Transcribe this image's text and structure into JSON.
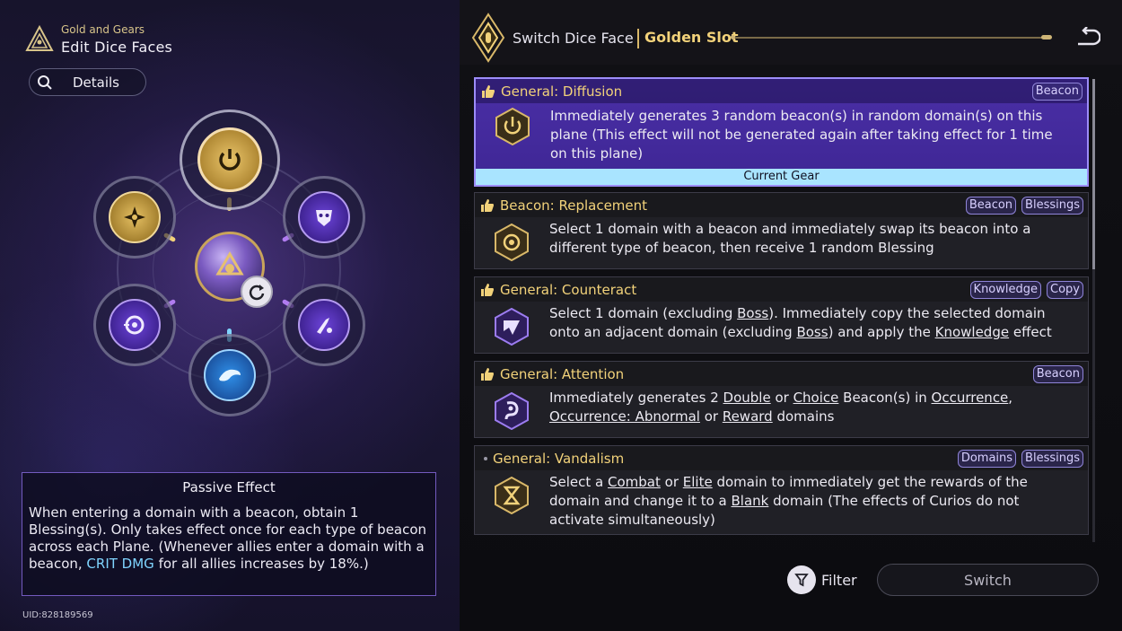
{
  "header": {
    "subtitle": "Gold and Gears",
    "title": "Edit Dice Faces",
    "logo_icon": "triangle-emblem-icon"
  },
  "details_button": {
    "label": "Details",
    "icon": "search-icon"
  },
  "dice_faces": [
    {
      "position": "top",
      "icon": "power-icon",
      "style": "gold"
    },
    {
      "position": "upper-left",
      "icon": "shuriken-icon",
      "style": "gold"
    },
    {
      "position": "upper-right",
      "icon": "mask-icon",
      "style": "purple"
    },
    {
      "position": "lower-left",
      "icon": "target-icon",
      "style": "purple"
    },
    {
      "position": "lower-right",
      "icon": "knife-icon",
      "style": "purple"
    },
    {
      "position": "bottom",
      "icon": "bird-icon",
      "style": "blue"
    }
  ],
  "passive": {
    "title": "Passive Effect",
    "text_before": "When entering a domain with a beacon, obtain 1 Blessing(s). Only takes effect once for each type of beacon across each Plane. (Whenever allies enter a domain with a beacon, ",
    "highlight": "CRIT DMG",
    "text_after": " for all allies increases by 18%.)"
  },
  "uid": "UID:828189569",
  "topbar": {
    "title": "Switch Dice Face",
    "slot": "Golden Slot"
  },
  "cards": [
    {
      "title": "General: Diffusion",
      "tags": [
        "Beacon"
      ],
      "selected": true,
      "icon": "power-icon",
      "desc": "Immediately generates 3 random beacon(s) in random domain(s) on this plane (This effect will not be generated again after taking effect for 1 time on this plane)",
      "current_label": "Current Gear"
    },
    {
      "title": "Beacon: Replacement",
      "tags": [
        "Beacon",
        "Blessings"
      ],
      "icon": "target-ring-icon",
      "desc": "Select 1 domain with a beacon and immediately swap its beacon into a different type of beacon, then receive 1 random Blessing"
    },
    {
      "title": "General: Counteract",
      "tags": [
        "Knowledge",
        "Copy"
      ],
      "icon": "arrow-swirl-icon",
      "desc_parts": [
        "Select 1 domain (excluding ",
        "Boss",
        "). Immediately copy the selected domain onto an adjacent domain (excluding ",
        "Boss",
        ") and apply the ",
        "Knowledge",
        " effect"
      ]
    },
    {
      "title": "General: Attention",
      "tags": [
        "Beacon"
      ],
      "icon": "hook-icon",
      "desc_parts": [
        "Immediately generates 2 ",
        "Double",
        " or ",
        "Choice",
        " Beacon(s) in ",
        "Occurrence",
        ", ",
        "Occurrence: Abnormal",
        " or ",
        "Reward",
        " domains"
      ]
    },
    {
      "title": "General: Vandalism",
      "tags": [
        "Domains",
        "Blessings"
      ],
      "icon": "hourglass-icon",
      "desc_parts": [
        "Select a ",
        "Combat",
        " or ",
        "Elite",
        " domain to immediately get the rewards of the domain and change it to a ",
        "Blank",
        " domain (The effects of Curios do not activate simultaneously)"
      ]
    }
  ],
  "filter": {
    "label": "Filter"
  },
  "switch": {
    "label": "Switch"
  },
  "colors": {
    "gold": "#f2d27a",
    "selected_card": "#4a2fa6",
    "current_bar": "#a9e4ff",
    "highlight": "#7fd4ff"
  }
}
